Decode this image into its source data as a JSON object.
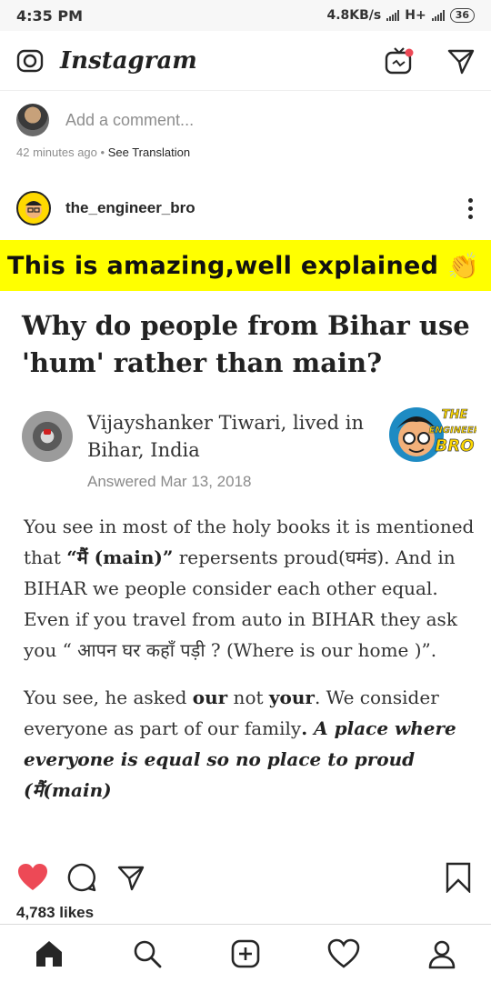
{
  "status_bar": {
    "time": "4:35 PM",
    "speed": "4.8KB/s",
    "network": "H+",
    "battery": "36"
  },
  "header": {
    "logo": "Instagram",
    "icons": [
      "camera-icon",
      "igtv-icon",
      "direct-message-icon"
    ]
  },
  "prev_post": {
    "comment_placeholder": "Add a comment...",
    "time_ago": "42 minutes ago",
    "separator": "•",
    "see_translation": "See Translation"
  },
  "post": {
    "username": "the_engineer_bro",
    "image": {
      "banner_text": "This is amazing,well explained",
      "banner_emoji": "👏",
      "question": "Why do people from Bihar use 'hum' rather than main?",
      "author": "Vijayshanker Tiwari, lived in Bihar, India",
      "answered": "Answered Mar 13, 2018",
      "badge_lines": [
        "THE",
        "ENGINEER",
        "BRO"
      ],
      "para1_a": "You see in most of the holy books it is mentioned that ",
      "para1_bold": "“मैं (main)”",
      "para1_b": " repersents proud(घमंड). And in BIHAR we people consider each other equal. Even if you travel from auto in BIHAR they ask you “ आपन घर कहाँ पड़ी ? (Where is our home )”.",
      "para2_a": "You see, he asked ",
      "para2_our": "our",
      "para2_b": " not ",
      "para2_your": "your",
      "para2_c": ". We consider everyone as part of our family",
      "para2_dot": ". ",
      "para2_emph": "A place where everyone is equal so no place to proud (मैं(main)"
    },
    "likes": "4,783 likes"
  },
  "bottom_nav": [
    "home-icon",
    "search-icon",
    "new-post-icon",
    "activity-icon",
    "profile-icon"
  ],
  "colors": {
    "banner": "#ffff00",
    "like_red": "#ed4956",
    "text": "#262626",
    "muted": "#8e8e8e"
  }
}
